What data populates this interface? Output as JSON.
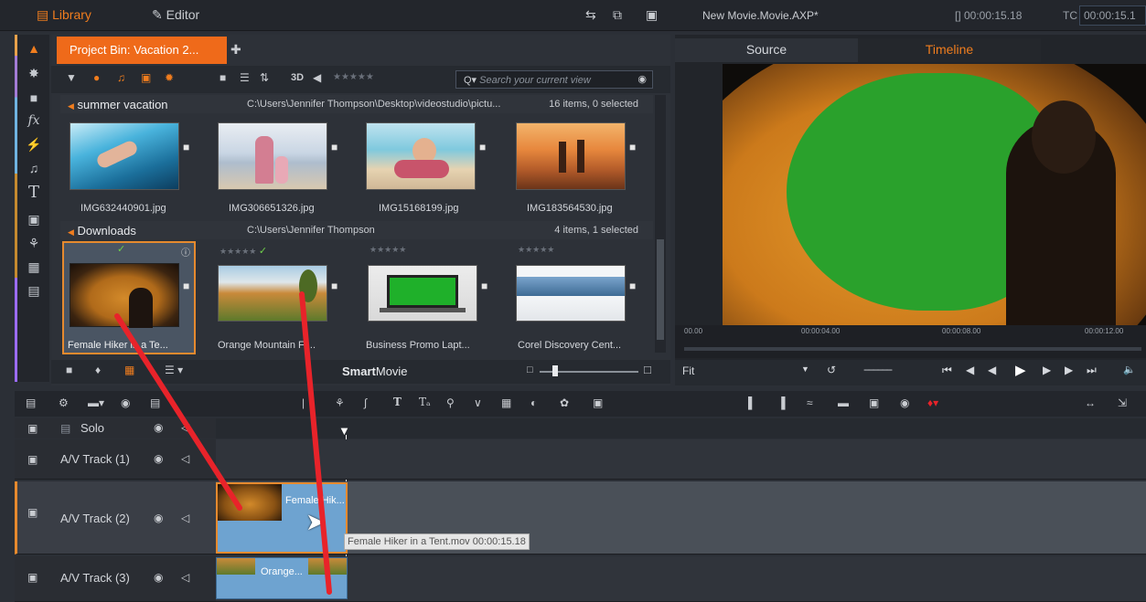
{
  "topbar": {
    "library_tab": "Library",
    "editor_tab": "Editor",
    "project_title": "New Movie.Movie.AXP*",
    "timecode_1": "[] 00:00:15.18",
    "tc_label": "TC",
    "timecode_2": "00:00:15.1"
  },
  "library": {
    "bin_tab": "Project Bin: Vacation 2...",
    "toolbar_3d": "3D",
    "search_placeholder": "Search your current view",
    "groups": [
      {
        "name": "summer vacation",
        "path": "C:\\Users\\Jennifer Thompson\\Desktop\\videostudio\\pictu...",
        "count": "16 items, 0 selected",
        "items": [
          {
            "label": "IMG632440901.jpg"
          },
          {
            "label": "IMG306651326.jpg"
          },
          {
            "label": "IMG15168199.jpg"
          },
          {
            "label": "IMG183564530.jpg"
          }
        ]
      },
      {
        "name": "Downloads",
        "path": "C:\\Users\\Jennifer Thompson",
        "count": "4 items, 1 selected",
        "items": [
          {
            "label": "Female Hiker in a Te..."
          },
          {
            "label": "Orange Mountain Fr..."
          },
          {
            "label": "Business Promo Lapt..."
          },
          {
            "label": "Corel Discovery Cent..."
          }
        ]
      }
    ],
    "footer_label_bold": "Smart",
    "footer_label": "Movie"
  },
  "preview": {
    "source_tab": "Source",
    "timeline_tab": "Timeline",
    "ruler": [
      "00.00",
      "00:00:04.00",
      "00:00:08.00",
      "00:00:12.00"
    ],
    "fit_label": "Fit"
  },
  "timeline": {
    "solo_label": "Solo",
    "tracks": [
      {
        "name": "A/V Track (1)"
      },
      {
        "name": "A/V Track (2)"
      },
      {
        "name": "A/V Track (3)"
      }
    ],
    "clip_female": "Female Hik...",
    "clip_orange": "Orange...",
    "tooltip": "Female Hiker in a Tent.mov  00:00:15.18"
  },
  "colors": {
    "accent": "#ef6a1a",
    "clip": "#6ea3d0",
    "annotation": "#e8232a"
  }
}
